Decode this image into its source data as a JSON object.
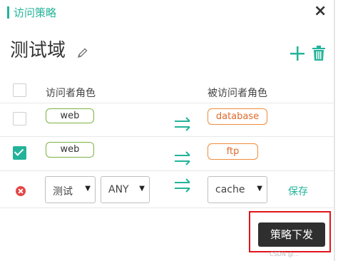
{
  "dialog": {
    "title": "访问策略",
    "close_label": "×"
  },
  "domain": {
    "name": "测试域"
  },
  "table": {
    "col_source": "访问者角色",
    "col_target": "被访问者角色",
    "rows": [
      {
        "checked": false,
        "source": "web",
        "target": "database"
      },
      {
        "checked": true,
        "source": "web",
        "target": "ftp"
      }
    ]
  },
  "new_row": {
    "domain_select": "测试",
    "any_select": "ANY",
    "target_select": "cache",
    "save_label": "保存"
  },
  "footer": {
    "deploy_label": "策略下发",
    "watermark": "CSDN @…"
  },
  "colors": {
    "accent": "#24b39a",
    "source_tag_border": "#7cb342",
    "target_tag_border": "#f08c3c",
    "highlight": "#e0151b",
    "deploy_button_bg": "#2f2f2f"
  },
  "icons": [
    "edit-pencil-icon",
    "plus-icon",
    "trash-icon",
    "swap-arrows-icon",
    "delete-circle-icon",
    "close-icon",
    "chevron-down-icon"
  ]
}
